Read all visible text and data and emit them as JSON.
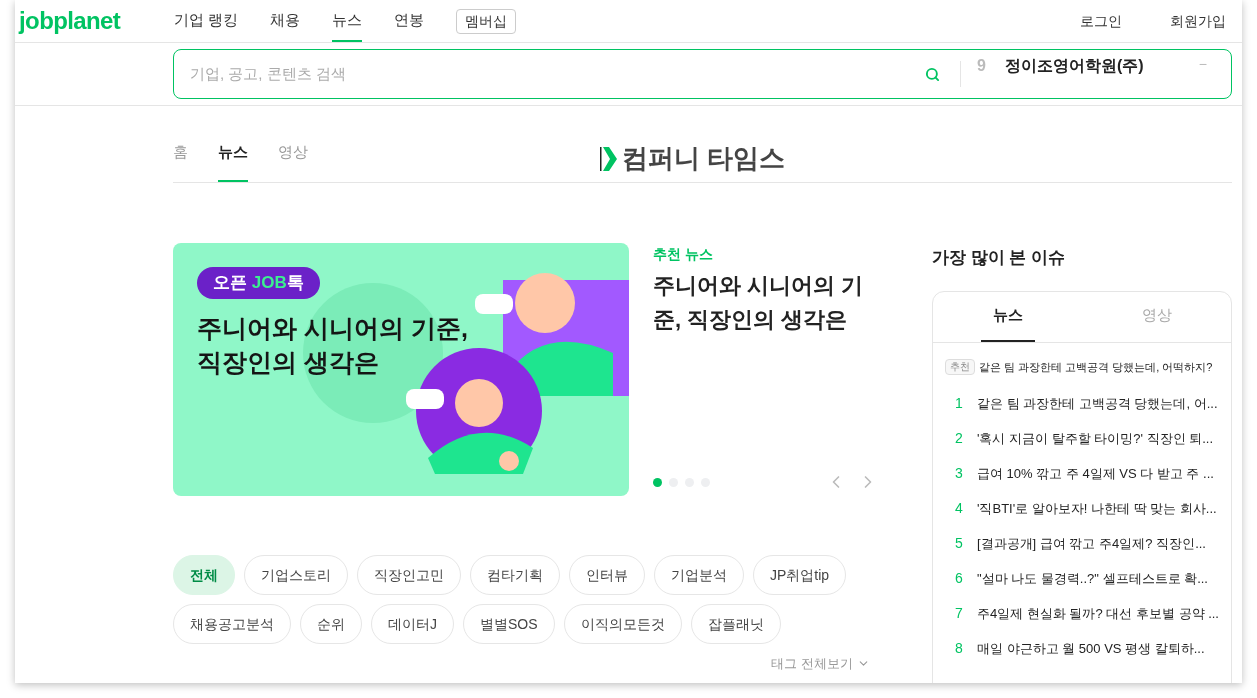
{
  "header": {
    "logo": "jobplanet",
    "nav": [
      {
        "label": "기업 랭킹",
        "selected": false
      },
      {
        "label": "채용",
        "selected": false
      },
      {
        "label": "뉴스",
        "selected": true
      },
      {
        "label": "연봉",
        "selected": false
      }
    ],
    "membership": "멤버십",
    "auth": [
      "로그인",
      "회원가입"
    ]
  },
  "search": {
    "placeholder": "기업, 공고, 콘텐츠 검색",
    "trending": {
      "rank": "9",
      "text": "정이조영어학원(주)",
      "change": "−"
    }
  },
  "subnav": {
    "tabs": [
      {
        "label": "홈",
        "selected": false
      },
      {
        "label": "뉴스",
        "selected": true
      },
      {
        "label": "영상",
        "selected": false
      }
    ],
    "brand": "컴퍼니 타임스"
  },
  "featured": {
    "banner": {
      "badge": {
        "before": "오픈 ",
        "highlight": "JOB",
        "after": "톡"
      },
      "title_lines": [
        "주니어와 시니어의 기준,",
        "직장인의 생각은"
      ]
    },
    "label": "추천 뉴스",
    "title": "주니어와 시니어의 기준, 직장인의 생각은",
    "dots": [
      {
        "selected": true
      },
      {
        "selected": false
      },
      {
        "selected": false
      },
      {
        "selected": false
      }
    ]
  },
  "tags": [
    {
      "label": "전체",
      "selected": true
    },
    {
      "label": "기업스토리",
      "selected": false
    },
    {
      "label": "직장인고민",
      "selected": false
    },
    {
      "label": "컴타기획",
      "selected": false
    },
    {
      "label": "인터뷰",
      "selected": false
    },
    {
      "label": "기업분석",
      "selected": false
    },
    {
      "label": "JP취업tip",
      "selected": false
    },
    {
      "label": "채용공고분석",
      "selected": false
    },
    {
      "label": "순위",
      "selected": false
    },
    {
      "label": "데이터J",
      "selected": false
    },
    {
      "label": "별별SOS",
      "selected": false
    },
    {
      "label": "이직의모든것",
      "selected": false
    },
    {
      "label": "잡플래닛",
      "selected": false
    }
  ],
  "tags_more": "태그 전체보기",
  "most_viewed": {
    "title": "가장 많이 본 이슈",
    "tabs": [
      {
        "label": "뉴스",
        "selected": true
      },
      {
        "label": "영상",
        "selected": false
      }
    ],
    "pick": {
      "badge": "추천",
      "text": "같은 팀 과장한테 고백공격 당했는데, 어떡하지?"
    },
    "items": [
      {
        "rank": "1",
        "text": "같은 팀 과장한테 고백공격 당했는데, 어..."
      },
      {
        "rank": "2",
        "text": "'혹시 지금이 탈주할 타이밍?' 직장인 퇴..."
      },
      {
        "rank": "3",
        "text": "급여 10% 깎고 주 4일제 VS 다 받고 주 ..."
      },
      {
        "rank": "4",
        "text": "'직BTI'로 알아보자! 나한테 딱 맞는 회사..."
      },
      {
        "rank": "5",
        "text": "[결과공개] 급여 깎고 주4일제? 직장인..."
      },
      {
        "rank": "6",
        "text": "\"설마 나도 물경력..?\" 셀프테스트로 확..."
      },
      {
        "rank": "7",
        "text": "주4일제 현실화 될까? 대선 후보별 공약 ..."
      },
      {
        "rank": "8",
        "text": "매일 야근하고 월 500 VS 평생 칼퇴하..."
      }
    ]
  }
}
